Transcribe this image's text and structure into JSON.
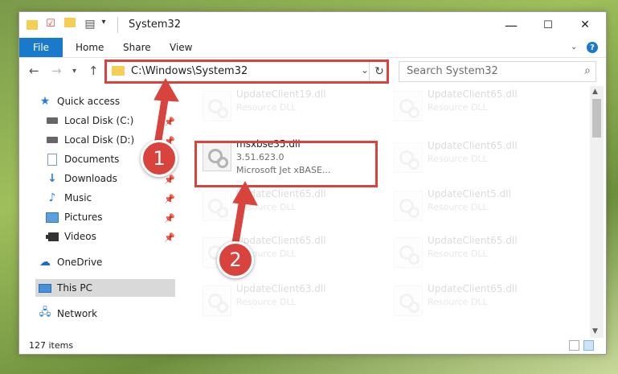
{
  "window": {
    "title": "System32",
    "controls": {
      "minimize": "—",
      "maximize": "☐",
      "close": "✕"
    }
  },
  "ribbon": {
    "file": "File",
    "tabs": [
      "Home",
      "Share",
      "View"
    ],
    "help": "?"
  },
  "address": {
    "path": "C:\\Windows\\System32"
  },
  "search": {
    "placeholder": "Search System32"
  },
  "sidebar": {
    "quick_access": "Quick access",
    "items": [
      {
        "label": "Local Disk (C:)",
        "icon": "drive-icon"
      },
      {
        "label": "Local Disk (D:)",
        "icon": "drive-icon"
      },
      {
        "label": "Documents",
        "icon": "documents-icon"
      },
      {
        "label": "Downloads",
        "icon": "downloads-icon"
      },
      {
        "label": "Music",
        "icon": "music-icon"
      },
      {
        "label": "Pictures",
        "icon": "pictures-icon"
      },
      {
        "label": "Videos",
        "icon": "videos-icon"
      }
    ],
    "onedrive": "OneDrive",
    "this_pc": "This PC",
    "network": "Network"
  },
  "files": {
    "highlight": {
      "name": "msxbse35.dll",
      "version": "3.51.623.0",
      "desc": "Microsoft Jet xBASE..."
    },
    "left": [
      {
        "name": "UpdateClient19.dll",
        "type": "Resource DLL"
      },
      {
        "name": "UpdateClient65.dll",
        "type": "Resource DLL"
      },
      {
        "name": "UpdateClient65.dll",
        "type": "Resource DLL"
      },
      {
        "name": "UpdateClient63.dll",
        "type": "Resource DLL"
      }
    ],
    "right": [
      {
        "name": "UpdateClient65.dll",
        "type": "Resource DLL"
      },
      {
        "name": "UpdateClient65.dll",
        "type": "Resource DLL"
      },
      {
        "name": "UpdateClient5.dll",
        "type": "Resource DLL"
      },
      {
        "name": "UpdateClient65.dll",
        "type": "Resource DLL"
      },
      {
        "name": "UpdateClient65.dll",
        "type": "Resource DLL"
      }
    ]
  },
  "status": {
    "count": "127 items"
  },
  "annotations": {
    "step1": "1",
    "step2": "2",
    "color": "#d9433e"
  }
}
